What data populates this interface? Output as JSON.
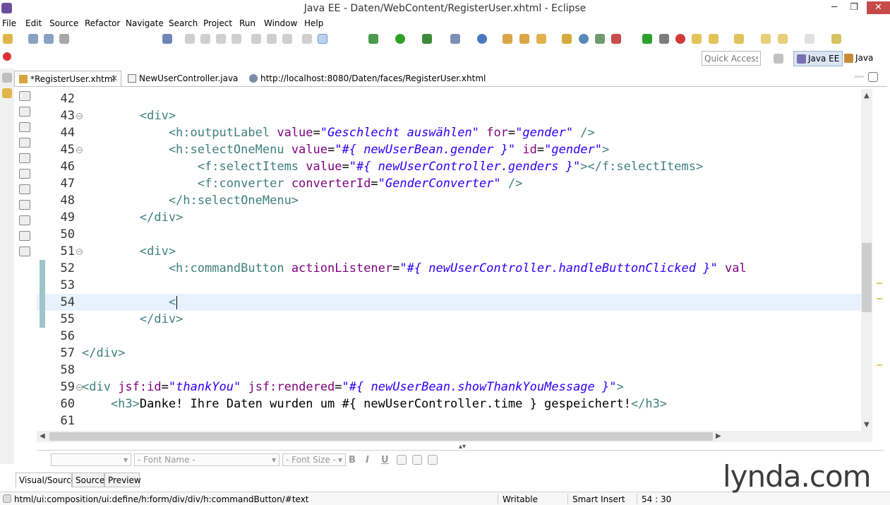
{
  "window": {
    "title": "Java EE - Daten/WebContent/RegisterUser.xhtml - Eclipse",
    "controls": {
      "minimize": "─",
      "maximize": "❐",
      "close": "✕"
    }
  },
  "menubar": {
    "items": [
      "File",
      "Edit",
      "Source",
      "Refactor",
      "Navigate",
      "Search",
      "Project",
      "Run",
      "Window",
      "Help"
    ]
  },
  "toolbar": {
    "quick_access_placeholder": "Quick Access",
    "perspectives": [
      {
        "label": "Java EE",
        "active": true,
        "icon": "java-ee-perspective-icon"
      },
      {
        "label": "Java",
        "active": false,
        "icon": "java-perspective-icon"
      }
    ]
  },
  "editor_tabs": [
    {
      "label": "*RegisterUser.xhtml",
      "active": true,
      "icon": "xhtml-file-icon",
      "close": "✕"
    },
    {
      "label": "NewUserController.java",
      "active": false,
      "icon": "java-file-icon"
    },
    {
      "label": "http://localhost:8080/Daten/faces/RegisterUser.xhtml",
      "active": false,
      "icon": "globe-icon"
    }
  ],
  "editor": {
    "current_line": 54,
    "lines": [
      {
        "n": "42",
        "parts": []
      },
      {
        "n": "43",
        "fold": true,
        "parts": [
          [
            "tag",
            "        <div>"
          ]
        ]
      },
      {
        "n": "44",
        "parts": [
          [
            "tag",
            "            <h:outputLabel "
          ],
          [
            "attr",
            "value"
          ],
          [
            "txt",
            "="
          ],
          [
            "str",
            "\"Geschlecht auswählen\""
          ],
          [
            "txt",
            " "
          ],
          [
            "attr",
            "for"
          ],
          [
            "txt",
            "="
          ],
          [
            "str",
            "\"gender\""
          ],
          [
            "tag",
            " />"
          ]
        ]
      },
      {
        "n": "45",
        "fold": true,
        "parts": [
          [
            "tag",
            "            <h:selectOneMenu "
          ],
          [
            "attr",
            "value"
          ],
          [
            "txt",
            "="
          ],
          [
            "str",
            "\"#{ newUserBean.gender }\""
          ],
          [
            "txt",
            " "
          ],
          [
            "attr",
            "id"
          ],
          [
            "txt",
            "="
          ],
          [
            "str",
            "\"gender\""
          ],
          [
            "tag",
            ">"
          ]
        ]
      },
      {
        "n": "46",
        "parts": [
          [
            "tag",
            "                <f:selectItems "
          ],
          [
            "attr",
            "value"
          ],
          [
            "txt",
            "="
          ],
          [
            "str",
            "\"#{ newUserController.genders }\""
          ],
          [
            "tag",
            "></f:selectItems>"
          ]
        ]
      },
      {
        "n": "47",
        "parts": [
          [
            "tag",
            "                <f:converter "
          ],
          [
            "attr",
            "converterId"
          ],
          [
            "txt",
            "="
          ],
          [
            "str",
            "\"GenderConverter\""
          ],
          [
            "tag",
            " />"
          ]
        ]
      },
      {
        "n": "48",
        "parts": [
          [
            "tag",
            "            </h:selectOneMenu>"
          ]
        ]
      },
      {
        "n": "49",
        "parts": [
          [
            "tag",
            "        </div>"
          ]
        ]
      },
      {
        "n": "50",
        "parts": []
      },
      {
        "n": "51",
        "fold": true,
        "parts": [
          [
            "tag",
            "        <div>"
          ]
        ]
      },
      {
        "n": "52",
        "changed": true,
        "parts": [
          [
            "tag",
            "            <h:commandButton "
          ],
          [
            "attr",
            "actionListener"
          ],
          [
            "txt",
            "="
          ],
          [
            "str",
            "\"#{ newUserController.handleButtonClicked }\""
          ],
          [
            "txt",
            " "
          ],
          [
            "attr",
            "val"
          ]
        ]
      },
      {
        "n": "53",
        "changed": true,
        "parts": []
      },
      {
        "n": "54",
        "changed": true,
        "parts": [
          [
            "tag",
            "            <"
          ]
        ]
      },
      {
        "n": "55",
        "changed": true,
        "parts": [
          [
            "tag",
            "        </div>"
          ]
        ]
      },
      {
        "n": "56",
        "parts": []
      },
      {
        "n": "57",
        "parts": [
          [
            "tag",
            "</div>"
          ]
        ]
      },
      {
        "n": "58",
        "parts": []
      },
      {
        "n": "59",
        "fold": true,
        "parts": [
          [
            "tag",
            "<div "
          ],
          [
            "attr",
            "jsf:id"
          ],
          [
            "txt",
            "="
          ],
          [
            "str",
            "\"thankYou\""
          ],
          [
            "txt",
            " "
          ],
          [
            "attr",
            "jsf:rendered"
          ],
          [
            "txt",
            "="
          ],
          [
            "str",
            "\"#{ newUserBean.showThankYouMessage }\""
          ],
          [
            "tag",
            ">"
          ]
        ]
      },
      {
        "n": "60",
        "parts": [
          [
            "tag",
            "    <h3>"
          ],
          [
            "txt",
            "Danke! Ihre Daten wurden um #{ newUserController.time } gespeichert!"
          ],
          [
            "tag",
            "</h3>"
          ]
        ]
      },
      {
        "n": "61",
        "parts": []
      }
    ]
  },
  "format_toolbar": {
    "style_combo": "",
    "font_name": "- Font Name -",
    "font_size": "- Font Size -",
    "buttons": [
      "B",
      "I",
      "U"
    ]
  },
  "bottom_tabs": [
    "Visual/Source",
    "Source",
    "Preview"
  ],
  "statusbar": {
    "path": "html/ui:composition/ui:define/h:form/div/div/h:commandButton/#text",
    "mode": "Writable",
    "insert": "Smart Insert",
    "position": "54 : 30"
  },
  "watermark": "lynda.com"
}
